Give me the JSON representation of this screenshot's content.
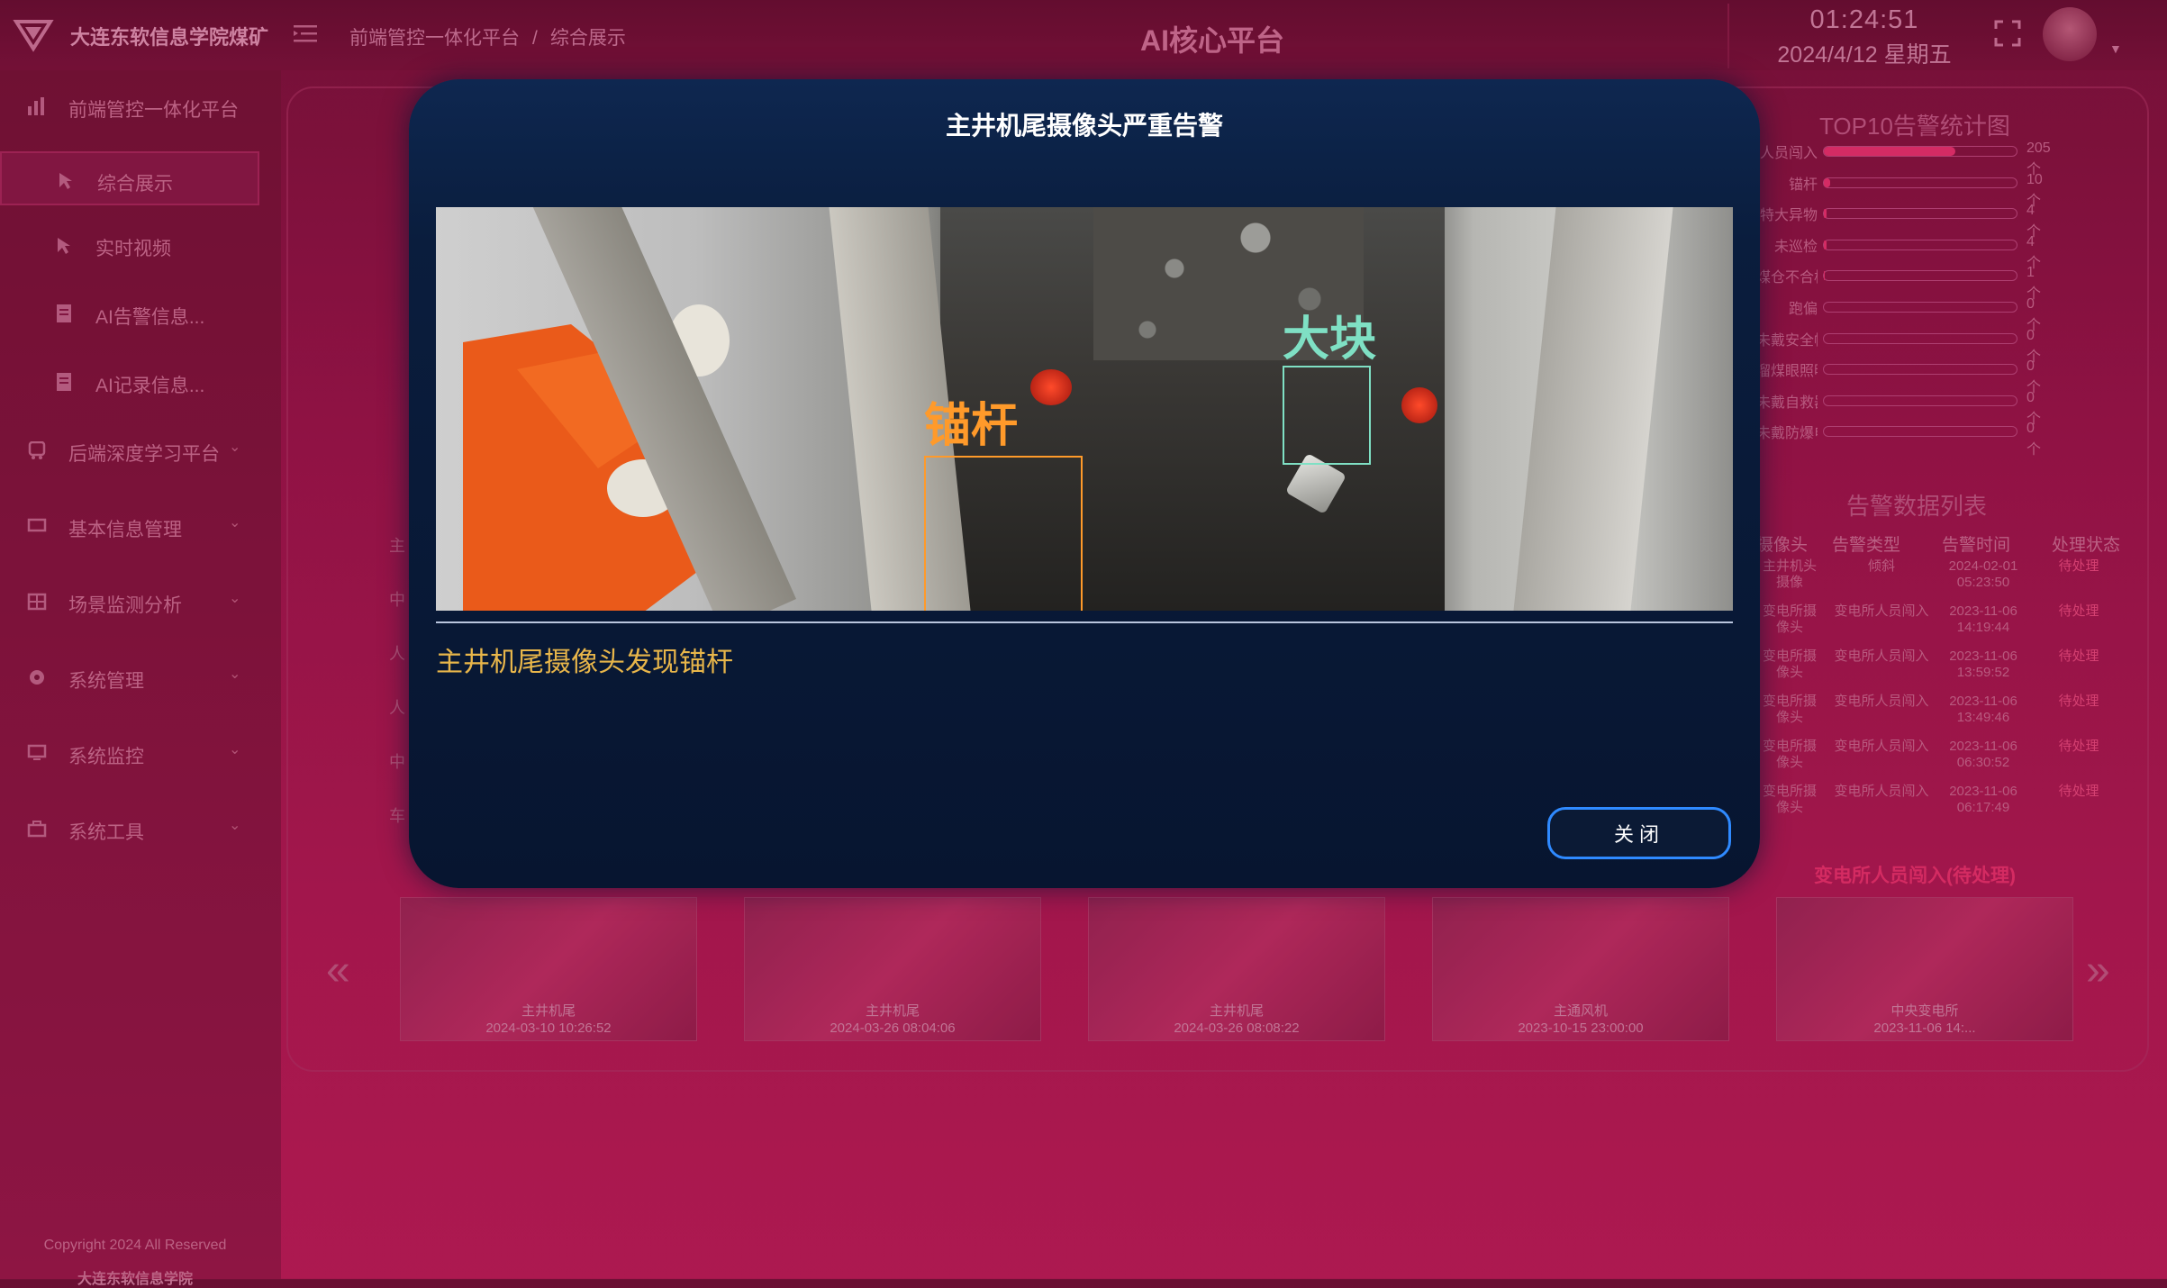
{
  "header": {
    "brand": "大连东软信息学院煤矿",
    "breadcrumb": [
      "前端管控一体化平台",
      "综合展示"
    ],
    "breadcrumb_sep": "/",
    "platform_title": "AI核心平台",
    "time": "01:24:51",
    "date": "2024/4/12 星期五"
  },
  "sidebar": {
    "items": [
      {
        "label": "前端管控一体化平台",
        "icon": "bar-chart-icon"
      },
      {
        "label": "综合展示",
        "icon": "pointer-icon"
      },
      {
        "label": "实时视频",
        "icon": "pointer-icon"
      },
      {
        "label": "AI告警信息...",
        "icon": "document-icon"
      },
      {
        "label": "AI记录信息...",
        "icon": "document-icon"
      },
      {
        "label": "后端深度学习平台",
        "icon": "train-icon"
      },
      {
        "label": "基本信息管理",
        "icon": "monitor-icon"
      },
      {
        "label": "场景监测分析",
        "icon": "grid-icon"
      },
      {
        "label": "系统管理",
        "icon": "gear-icon"
      },
      {
        "label": "系统监控",
        "icon": "screen-icon"
      },
      {
        "label": "系统工具",
        "icon": "toolbox-icon"
      }
    ],
    "active_label": "综合展示",
    "copyright": "Copyright 2024 All Reserved",
    "org": "大连东软信息学院"
  },
  "background": {
    "top10_title": "TOP10告警统计图",
    "top10": [
      {
        "cat": "人员闯入",
        "value": 205,
        "count": "205个"
      },
      {
        "cat": "锚杆",
        "value": 10,
        "count": "10个"
      },
      {
        "cat": "特大异物",
        "value": 4,
        "count": "4个"
      },
      {
        "cat": "未巡检",
        "value": 4,
        "count": "4个"
      },
      {
        "cat": "煤仓不合格",
        "value": 1,
        "count": "1个"
      },
      {
        "cat": "跑偏",
        "value": 0,
        "count": "0个"
      },
      {
        "cat": "未戴安全帽",
        "value": 0,
        "count": "0个"
      },
      {
        "cat": "溜煤眼照明灯",
        "value": 0,
        "count": "0个"
      },
      {
        "cat": "未戴自救器",
        "value": 0,
        "count": "0个"
      },
      {
        "cat": "未戴防爆电源",
        "value": 0,
        "count": "0个"
      }
    ],
    "alarm_list_title": "告警数据列表",
    "alarm_headers": [
      "摄像头",
      "告警类型",
      "告警时间",
      "处理状态"
    ],
    "alarm_rows": [
      {
        "cam": "主井机头摄像",
        "type": "倾斜",
        "time": "2024-02-01 05:23:50",
        "status": "待处理"
      },
      {
        "cam": "变电所摄像头",
        "type": "变电所人员闯入",
        "time": "2023-11-06 14:19:44",
        "status": "待处理"
      },
      {
        "cam": "变电所摄像头",
        "type": "变电所人员闯入",
        "time": "2023-11-06 13:59:52",
        "status": "待处理"
      },
      {
        "cam": "变电所摄像头",
        "type": "变电所人员闯入",
        "time": "2023-11-06 13:49:46",
        "status": "待处理"
      },
      {
        "cam": "变电所摄像头",
        "type": "变电所人员闯入",
        "time": "2023-11-06 06:30:52",
        "status": "待处理"
      },
      {
        "cam": "变电所摄像头",
        "type": "变电所人员闯入",
        "time": "2023-11-06 06:17:49",
        "status": "待处理"
      }
    ],
    "left_rows": [
      "主",
      "中",
      "人",
      "人",
      "中",
      "车"
    ],
    "footnote": "变电所人员闯入(待处理)"
  },
  "thumbnails": [
    {
      "name": "主井机尾",
      "time": "2024-03-10 10:26:52"
    },
    {
      "name": "主井机尾",
      "time": "2024-03-26 08:04:06"
    },
    {
      "name": "主井机尾",
      "time": "2024-03-26 08:08:22"
    },
    {
      "name": "主通风机",
      "time": "2023-10-15 23:00:00"
    },
    {
      "name": "中央变电所",
      "time": "2023-11-06 14:..."
    }
  ],
  "nav": {
    "prev": "«",
    "next": "»"
  },
  "modal": {
    "title": "主井机尾摄像头严重告警",
    "labels": {
      "bolt": "锚杆",
      "lump": "大块"
    },
    "label_colors": {
      "bolt": "#ff9a2a",
      "lump": "#7fe0c4"
    },
    "description": "主井机尾摄像头发现锚杆",
    "close_label": "关闭"
  }
}
